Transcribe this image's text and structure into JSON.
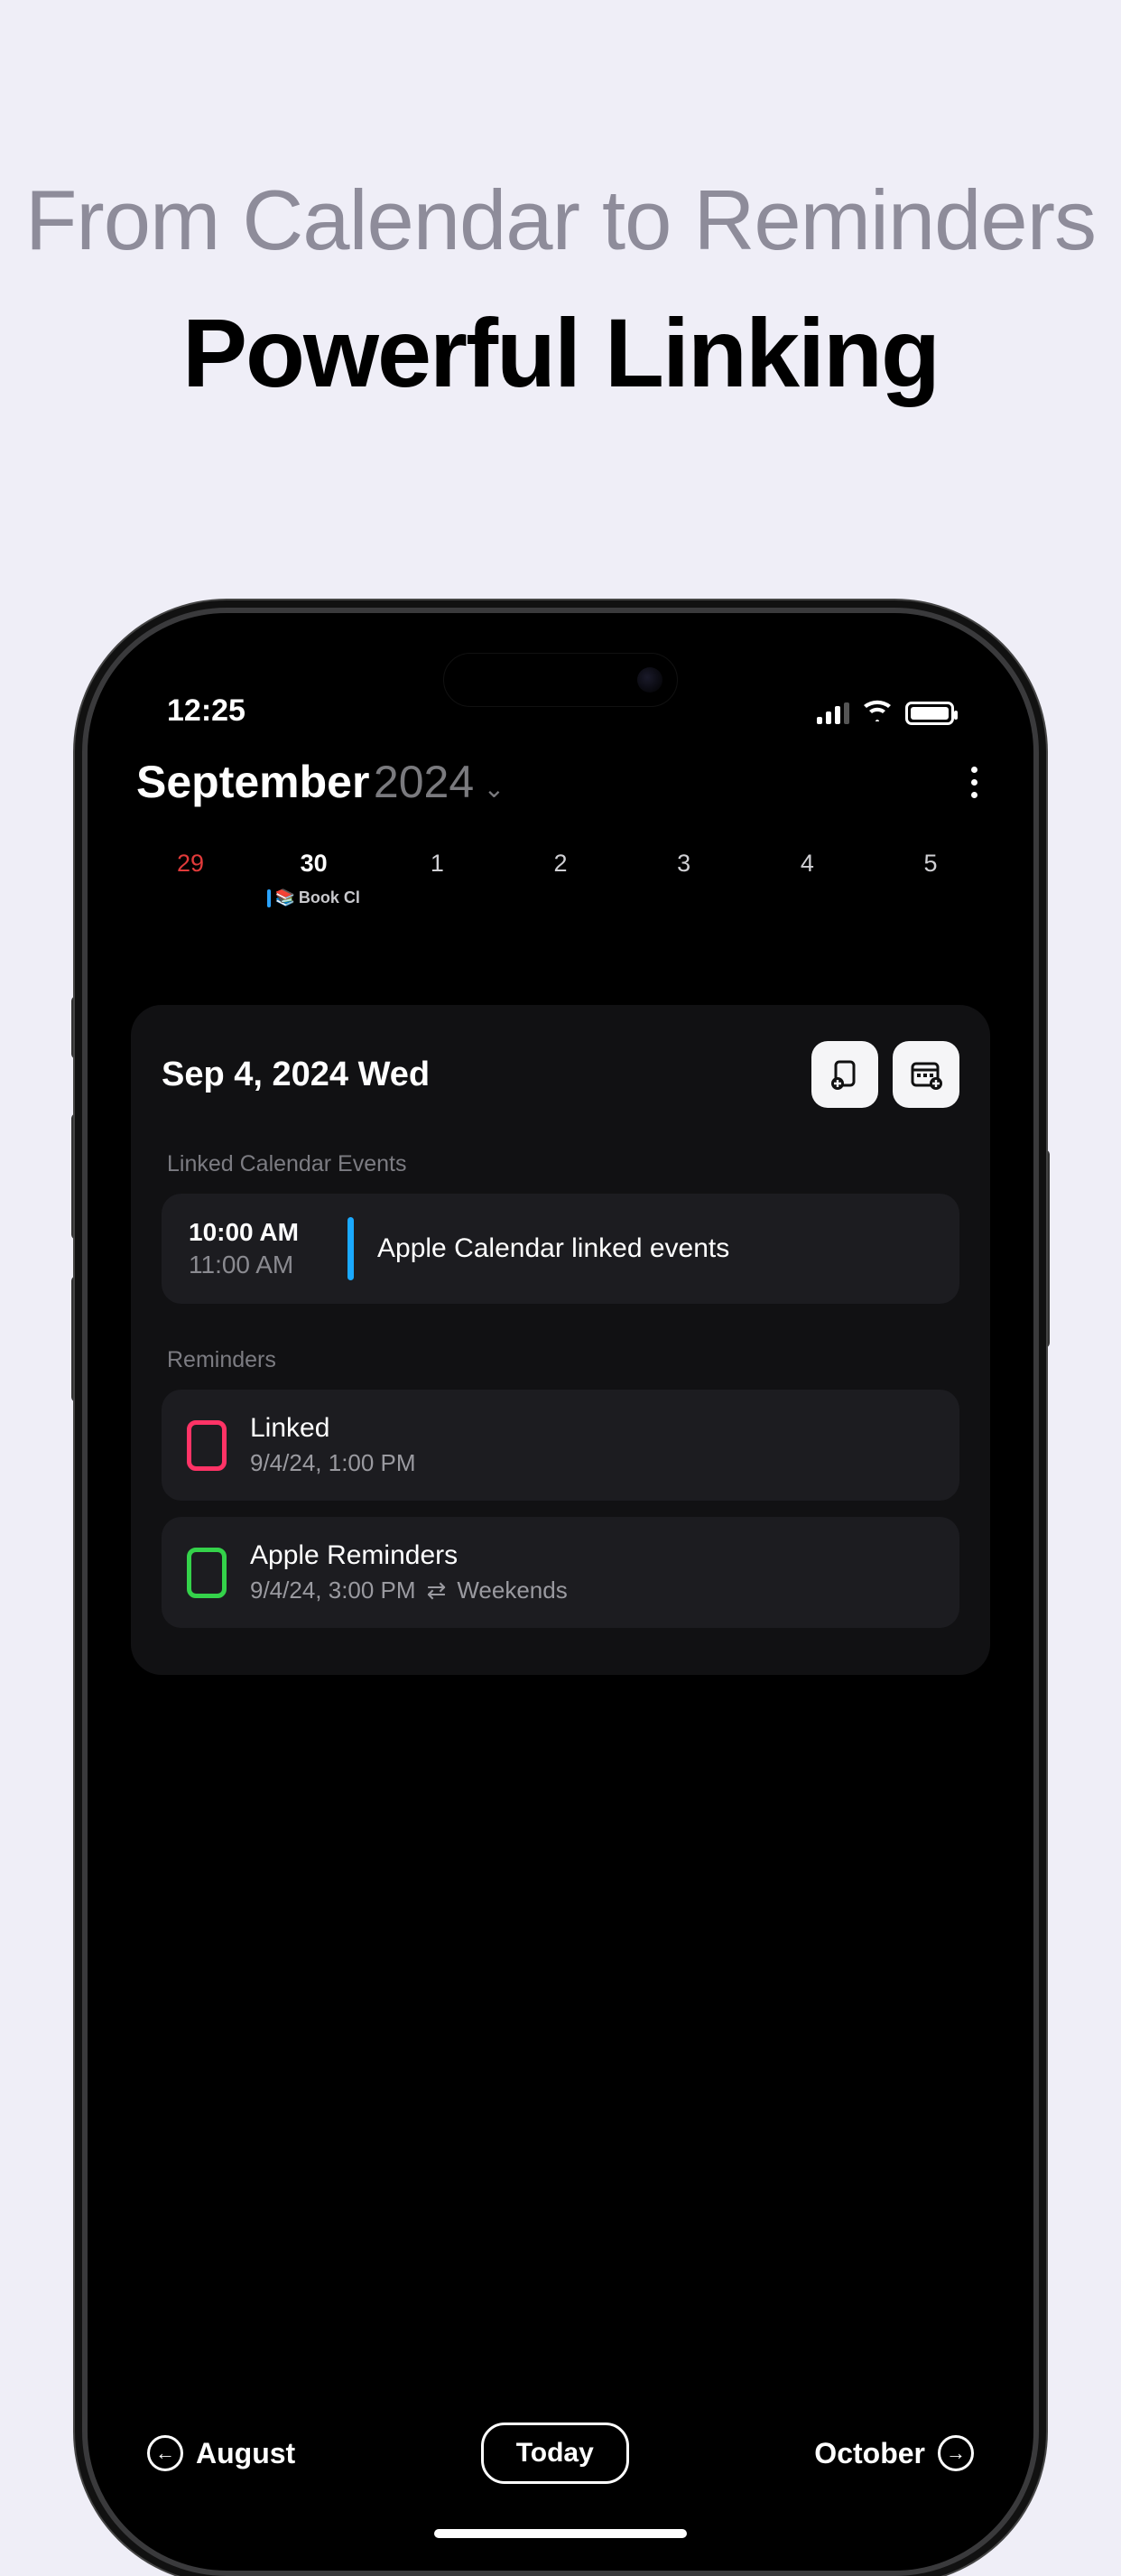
{
  "promo": {
    "subtitle": "From Calendar to Reminders",
    "title": "Powerful Linking"
  },
  "status": {
    "time": "12:25"
  },
  "header": {
    "month": "September",
    "year": "2024"
  },
  "week": {
    "days": [
      {
        "num": "29",
        "style": "red"
      },
      {
        "num": "30",
        "style": "bold",
        "event": "Book Cl"
      },
      {
        "num": "1"
      },
      {
        "num": "2"
      },
      {
        "num": "3"
      },
      {
        "num": "4"
      },
      {
        "num": "5"
      }
    ]
  },
  "card": {
    "date": "Sep 4, 2024 Wed",
    "events_label": "Linked Calendar Events",
    "event": {
      "start": "10:00 AM",
      "end": "11:00 AM",
      "title": "Apple Calendar linked events"
    },
    "reminders_label": "Reminders",
    "reminders": [
      {
        "title": "Linked",
        "sub": "9/4/24, 1:00 PM",
        "color": "pink"
      },
      {
        "title": "Apple Reminders",
        "sub": "9/4/24, 3:00 PM",
        "repeat": "Weekends",
        "color": "green"
      }
    ]
  },
  "nav": {
    "prev": "August",
    "today": "Today",
    "next": "October"
  }
}
